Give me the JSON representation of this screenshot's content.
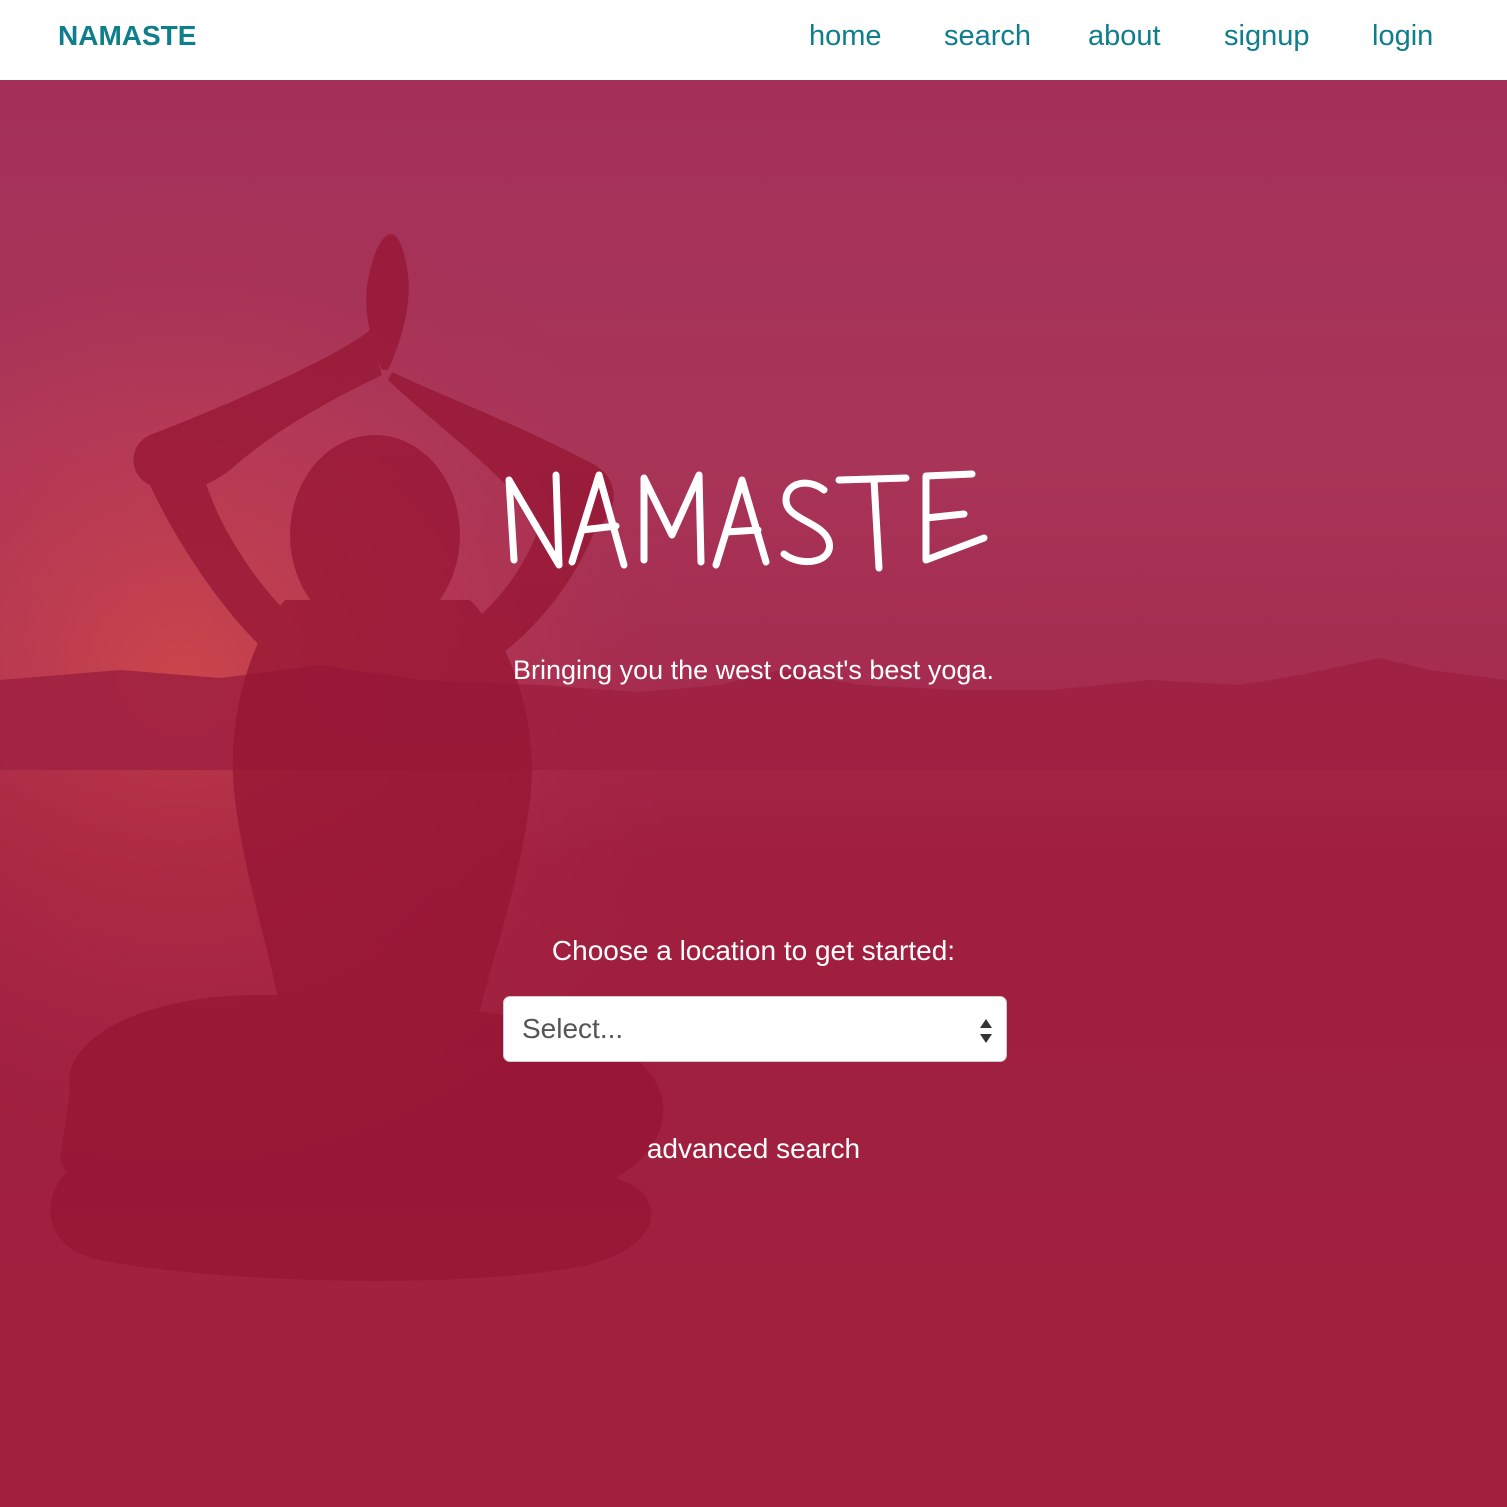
{
  "navbar": {
    "brand": "NAMASTE",
    "links": [
      {
        "label": "home"
      },
      {
        "label": "search"
      },
      {
        "label": "about"
      },
      {
        "label": "signup"
      },
      {
        "label": "login"
      }
    ]
  },
  "hero": {
    "title": "NAMASTE",
    "tagline": "Bringing you the west coast's best yoga.",
    "location_prompt": "Choose a location to get started:",
    "location_select": {
      "selected": "Select..."
    },
    "advanced_search": "advanced search"
  },
  "colors": {
    "nav_text": "#0f7e8c",
    "hero_overlay": "#a0213f",
    "hero_text": "#ffffff"
  },
  "icons": {
    "select_arrows": "up-down-arrows-icon"
  }
}
